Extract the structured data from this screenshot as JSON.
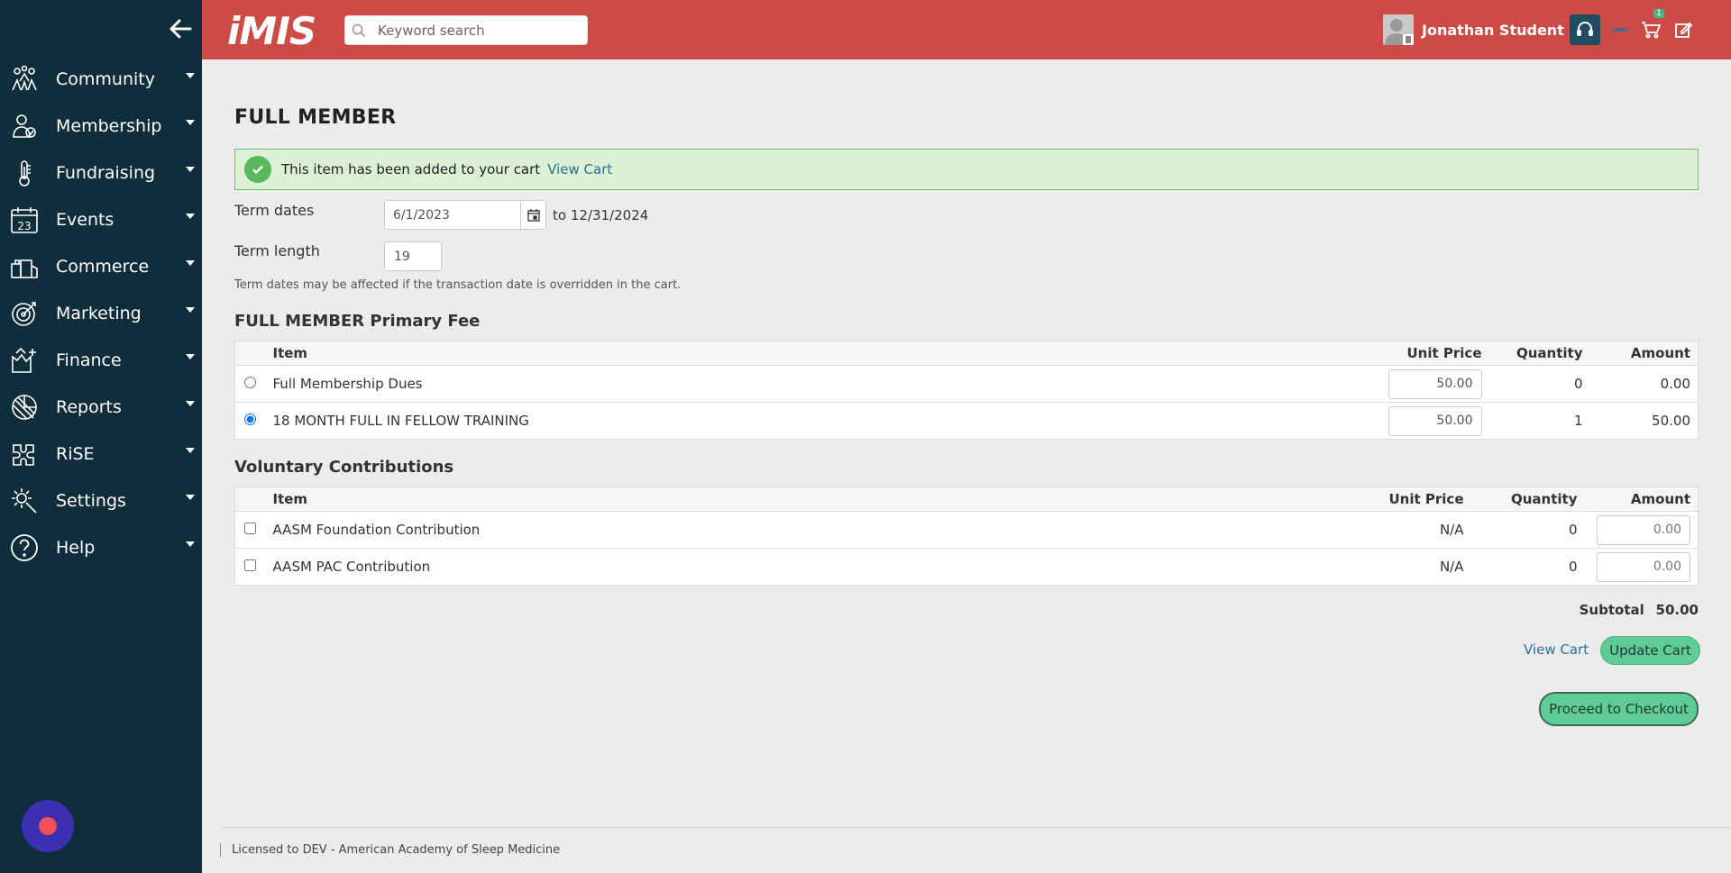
{
  "header": {
    "logo": "iMIS",
    "search_placeholder": "Keyword search",
    "user_name": "Jonathan Student",
    "cart_count": "1",
    "brand_color": "#cd4b47"
  },
  "sidebar": {
    "items": [
      {
        "label": "Community",
        "icon": "community-icon"
      },
      {
        "label": "Membership",
        "icon": "membership-icon"
      },
      {
        "label": "Fundraising",
        "icon": "fundraising-icon"
      },
      {
        "label": "Events",
        "icon": "events-icon"
      },
      {
        "label": "Commerce",
        "icon": "commerce-icon"
      },
      {
        "label": "Marketing",
        "icon": "marketing-icon"
      },
      {
        "label": "Finance",
        "icon": "finance-icon"
      },
      {
        "label": "Reports",
        "icon": "reports-icon"
      },
      {
        "label": "RiSE",
        "icon": "rise-icon"
      },
      {
        "label": "Settings",
        "icon": "settings-icon"
      },
      {
        "label": "Help",
        "icon": "help-icon"
      }
    ],
    "events_icon_number": "23",
    "bg_color": "#0f2d3b"
  },
  "main": {
    "title": "FULL MEMBER",
    "alert": {
      "message": "This item has been added to your cart",
      "link": "View Cart"
    },
    "term_dates_label": "Term dates",
    "term_start": "6/1/2023",
    "term_end_text": "to 12/31/2024",
    "term_length_label": "Term length",
    "term_length": "19",
    "note": "Term dates may be affected if the transaction date is overridden in the cart.",
    "primary_fee": {
      "title": "FULL MEMBER Primary Fee",
      "headers": {
        "item": "Item",
        "unit_price": "Unit Price",
        "quantity": "Quantity",
        "amount": "Amount"
      },
      "rows": [
        {
          "item": "Full Membership Dues",
          "unit_price": "50.00",
          "quantity": "0",
          "amount": "0.00",
          "selected": false
        },
        {
          "item": "18 MONTH FULL IN FELLOW TRAINING",
          "unit_price": "50.00",
          "quantity": "1",
          "amount": "50.00",
          "selected": true
        }
      ]
    },
    "contributions": {
      "title": "Voluntary Contributions",
      "headers": {
        "item": "Item",
        "unit_price": "Unit Price",
        "quantity": "Quantity",
        "amount": "Amount"
      },
      "rows": [
        {
          "item": "AASM Foundation Contribution",
          "unit_price": "N/A",
          "quantity": "0",
          "amount": "0.00",
          "checked": false
        },
        {
          "item": "AASM PAC Contribution",
          "unit_price": "N/A",
          "quantity": "0",
          "amount": "0.00",
          "checked": false
        }
      ]
    },
    "subtotal_label": "Subtotal",
    "subtotal_value": "50.00",
    "view_cart": "View Cart",
    "update_cart": "Update Cart",
    "checkout": "Proceed to Checkout"
  },
  "footer": {
    "text": "Licensed to DEV - American Academy of Sleep Medicine"
  }
}
